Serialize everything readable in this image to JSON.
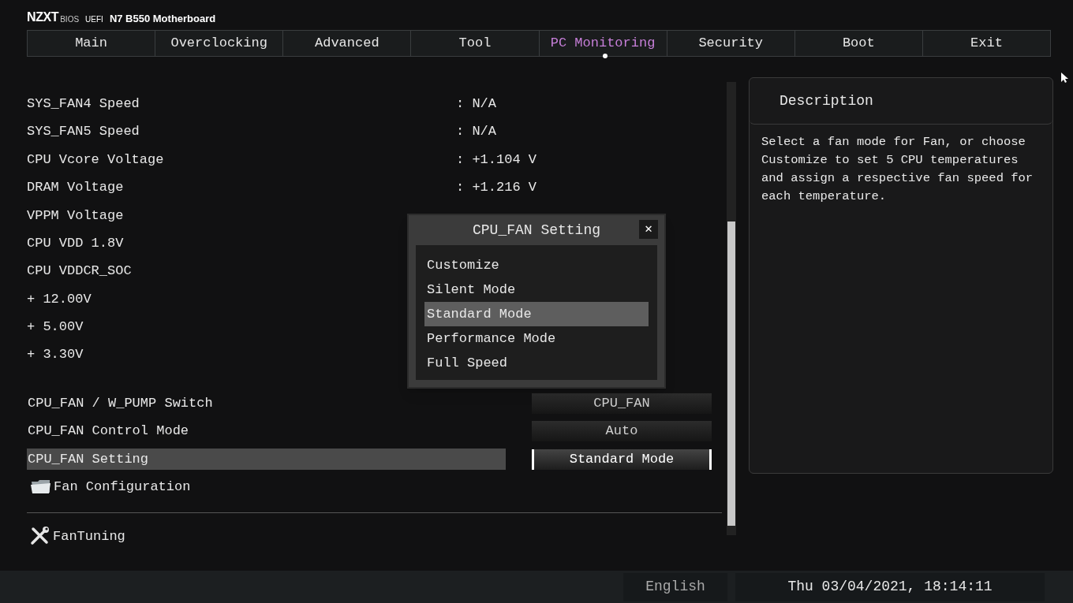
{
  "header": {
    "brand": "NZXT",
    "brand_sub": "BIOS",
    "firmware": "UEFI",
    "board": "N7 B550 Motherboard"
  },
  "tabs": [
    {
      "label": "Main",
      "selected": false
    },
    {
      "label": "Overclocking",
      "selected": false
    },
    {
      "label": "Advanced",
      "selected": false
    },
    {
      "label": "Tool",
      "selected": false
    },
    {
      "label": "PC Monitoring",
      "selected": true
    },
    {
      "label": "Security",
      "selected": false
    },
    {
      "label": "Boot",
      "selected": false
    },
    {
      "label": "Exit",
      "selected": false
    }
  ],
  "readings": [
    {
      "label": "SYS_FAN4 Speed",
      "value": ": N/A"
    },
    {
      "label": "SYS_FAN5 Speed",
      "value": ": N/A"
    },
    {
      "label": "CPU Vcore Voltage",
      "value": ": +1.104 V"
    },
    {
      "label": "DRAM Voltage",
      "value": ": +1.216 V"
    },
    {
      "label": "VPPM Voltage"
    },
    {
      "label": "CPU VDD 1.8V"
    },
    {
      "label": "CPU VDDCR_SOC"
    },
    {
      "label": "+ 12.00V"
    },
    {
      "label": "+ 5.00V"
    },
    {
      "label": "+ 3.30V"
    }
  ],
  "settings": [
    {
      "label": "CPU_FAN / W_PUMP Switch",
      "value": "CPU_FAN",
      "selected": false
    },
    {
      "label": "CPU_FAN Control Mode",
      "value": "Auto",
      "selected": false
    },
    {
      "label": "CPU_FAN Setting",
      "value": "Standard Mode",
      "selected": true
    }
  ],
  "submenu": {
    "label": "Fan Configuration"
  },
  "tool": {
    "label": "FanTuning"
  },
  "description": {
    "title": "Description",
    "text": "Select a fan mode for Fan, or choose Customize to set 5 CPU temperatures and assign a respective fan speed for each temperature."
  },
  "dialog": {
    "title": "CPU_FAN Setting",
    "close": "✕",
    "options": [
      {
        "label": "Customize",
        "selected": false
      },
      {
        "label": "Silent Mode",
        "selected": false
      },
      {
        "label": "Standard Mode",
        "selected": true
      },
      {
        "label": "Performance Mode",
        "selected": false
      },
      {
        "label": "Full Speed",
        "selected": false
      }
    ]
  },
  "status_bar": {
    "language": "English",
    "datetime": "Thu 03/04/2021, 18:14:11"
  }
}
